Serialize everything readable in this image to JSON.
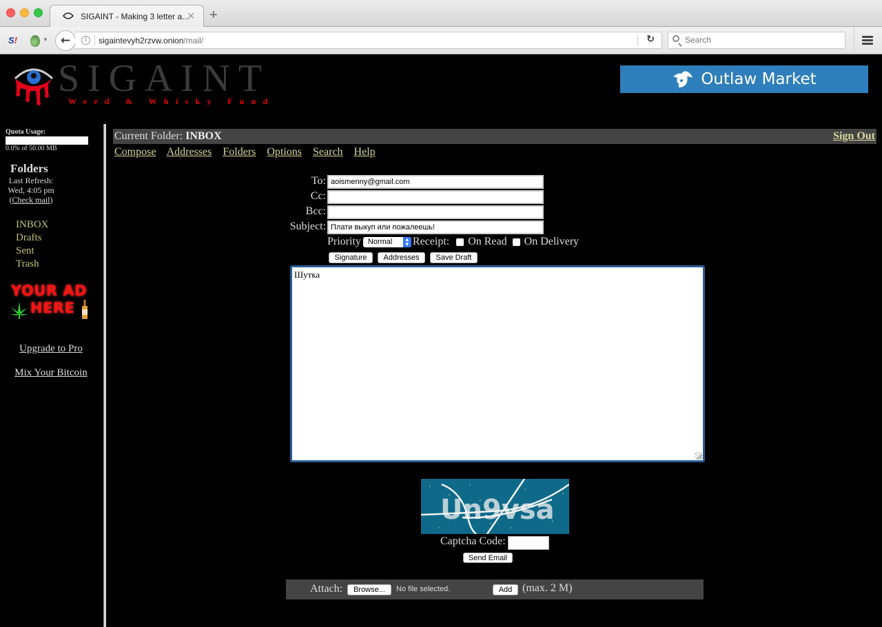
{
  "browser": {
    "tab_title": "SIGAINT - Making 3 letter a...",
    "url_host": "sigaintevyh2rzvw.onion",
    "url_path": "/mail/",
    "search_placeholder": "Search",
    "new_tab_label": "+",
    "close_tab_label": "✕"
  },
  "header": {
    "logo_text": "SIGAINT",
    "logo_tagline": "Weed & Whisky Fund",
    "ad_banner_label": "Outlaw Market",
    "ad_banner_color": "#2e7fbb"
  },
  "sidebar": {
    "quota_label": "Quota Usage:",
    "quota_percent": 0.0,
    "quota_text": "0.0% of 50.00 MB",
    "folders_title": "Folders",
    "last_refresh_label": "Last Refresh:",
    "last_refresh_time": "Wed, 4:05 pm",
    "check_mail_open": "(",
    "check_mail_label": "Check mail",
    "check_mail_close": ")",
    "folders": [
      "INBOX",
      "Drafts",
      "Sent",
      "Trash"
    ],
    "ad_line1": "YOUR AD",
    "ad_line2": "HERE",
    "upgrade_link": "Upgrade to Pro",
    "mix_link": "Mix Your Bitcoin"
  },
  "main": {
    "current_folder_label": "Current Folder:",
    "current_folder": "INBOX",
    "sign_out": "Sign Out",
    "nav": [
      "Compose",
      "Addresses",
      "Folders",
      "Options",
      "Search",
      "Help"
    ],
    "link_color": "#d8d49c"
  },
  "compose": {
    "to_label": "To:",
    "to_value": "aoismenny@gmail.com",
    "cc_label": "Cc:",
    "cc_value": "",
    "bcc_label": "Bcc:",
    "bcc_value": "",
    "subject_label": "Subject:",
    "subject_value": "Плати выкуп или пожалеешь!",
    "priority_label": "Priority",
    "priority_value": "Normal",
    "receipt_label": "Receipt:",
    "on_read_label": "On Read",
    "on_read_checked": false,
    "on_delivery_label": "On Delivery",
    "on_delivery_checked": false,
    "signature_button": "Signature",
    "addresses_button": "Addresses",
    "save_draft_button": "Save Draft",
    "body_value": "Шутка",
    "captcha_text": "Un9vsa",
    "captcha_label": "Captcha Code:",
    "captcha_value": "",
    "send_button": "Send Email",
    "attach_label": "Attach:",
    "browse_button": "Browse...",
    "no_file_text": "No file selected.",
    "add_button": "Add",
    "max_note": "(max. 2 M)"
  }
}
